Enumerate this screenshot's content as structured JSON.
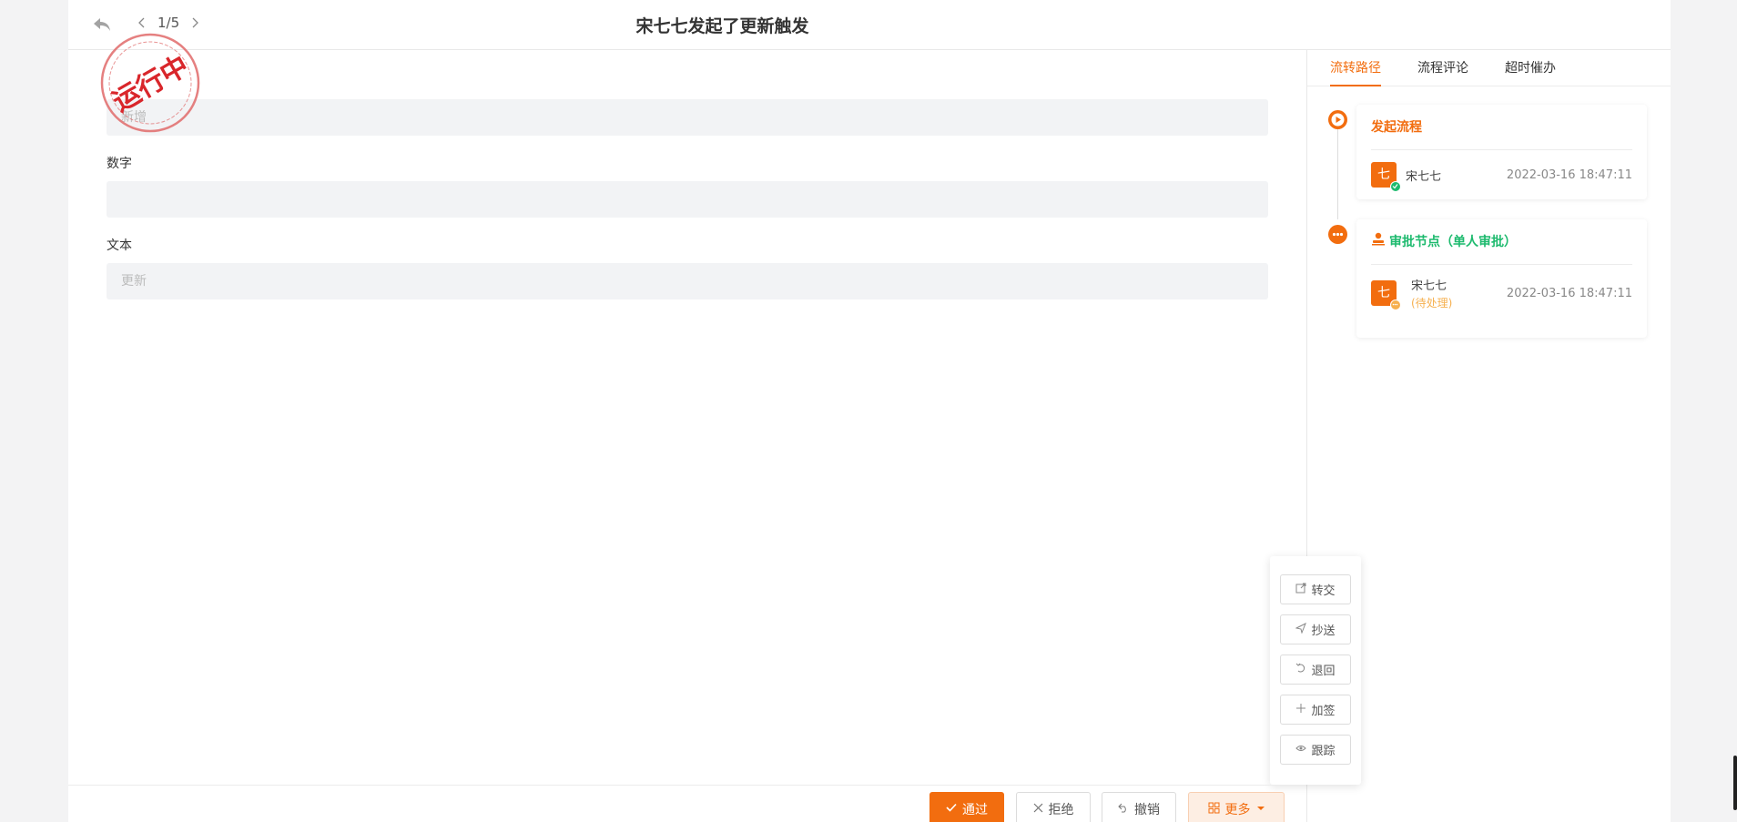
{
  "header": {
    "title": "宋七七发起了更新触发",
    "pager": "1/5"
  },
  "stamp": {
    "text": "运行中",
    "color": "#d9262b"
  },
  "form": {
    "fields": [
      {
        "label": "",
        "value": "新增"
      },
      {
        "label": "数字",
        "value": ""
      },
      {
        "label": "文本",
        "value": "更新"
      }
    ]
  },
  "sidebar": {
    "tabs": [
      "流转路径",
      "流程评论",
      "超时催办"
    ],
    "nodes": [
      {
        "title": "发起流程",
        "title_color": "#f26d0f",
        "avatar": "七",
        "name": "宋七七",
        "status": "",
        "time": "2022-03-16 18:47:11"
      },
      {
        "title": "审批节点（单人审批）",
        "title_color": "#1dba6e",
        "avatar": "七",
        "name": "宋七七",
        "status": "(待处理)",
        "time": "2022-03-16 18:47:11"
      }
    ]
  },
  "actions": {
    "pass": "通过",
    "reject": "拒绝",
    "revoke": "撤销",
    "more": "更多"
  },
  "more_menu": [
    "转交",
    "抄送",
    "退回",
    "加签",
    "跟踪"
  ],
  "colors": {
    "accent": "#f26d0f",
    "success": "#1dba6e",
    "pending": "#f6b04f"
  }
}
